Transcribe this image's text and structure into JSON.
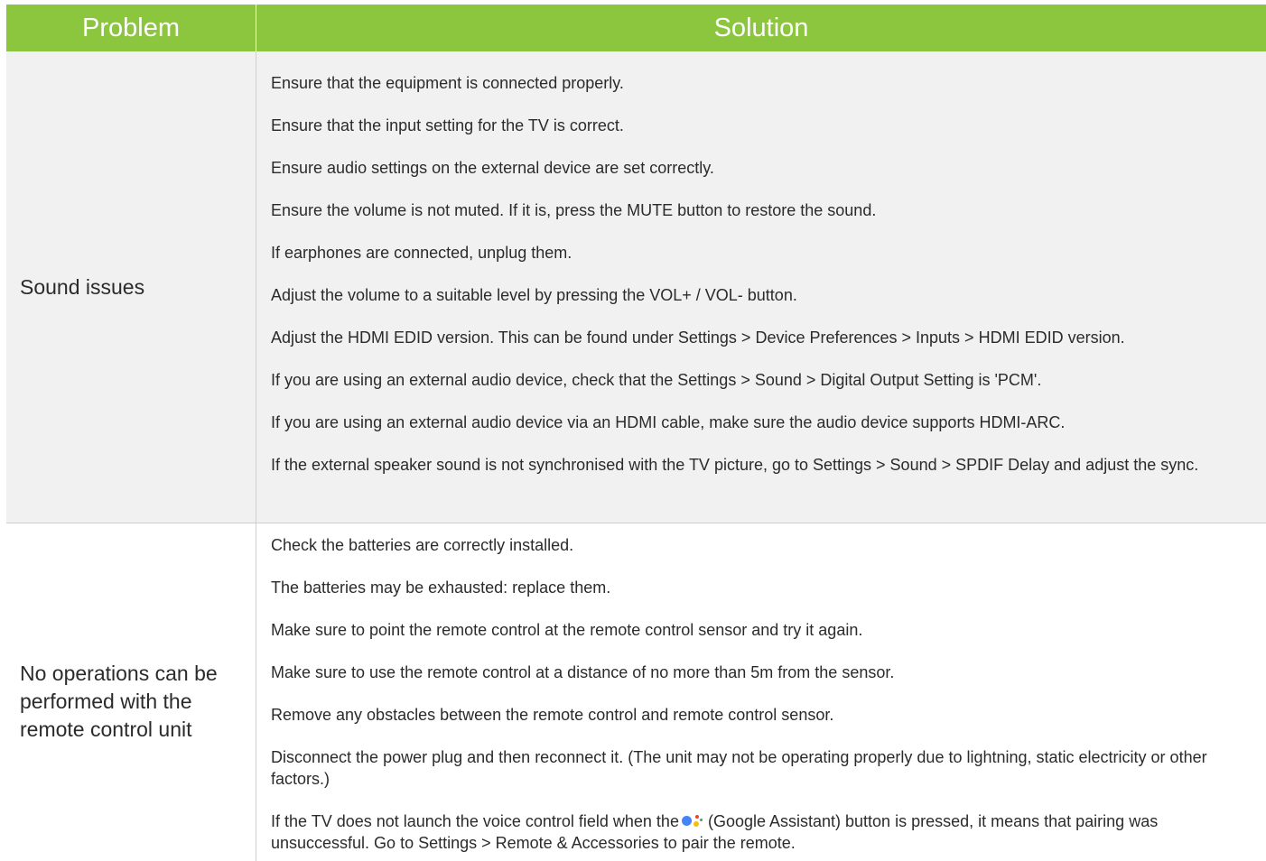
{
  "header": {
    "problem": "Problem",
    "solution": "Solution"
  },
  "rows": [
    {
      "problem": "Sound issues",
      "solutions": [
        "Ensure that the equipment is connected properly.",
        "Ensure that the input setting for the TV is correct.",
        "Ensure audio settings on the external device are set correctly.",
        "Ensure the volume is not muted. If it is, press the MUTE button to restore the sound.",
        "If earphones are connected, unplug them.",
        "Adjust the volume to a suitable level by pressing the VOL+ / VOL- button.",
        "Adjust the HDMI EDID version. This can be found under Settings > Device Preferences > Inputs > HDMI EDID version.",
        "If you are using an external audio device, check that the  Settings > Sound > Digital Output Setting is 'PCM'.",
        "If you are using an external audio device via an HDMI cable, make sure the audio device supports HDMI-ARC.",
        "If the external speaker sound is not synchronised with the TV picture, go to Settings > Sound > SPDIF Delay and adjust the sync."
      ]
    },
    {
      "problem": "No operations can be performed with the remote control unit",
      "solutions": [
        "Check the batteries are correctly installed.",
        "The batteries may be exhausted: replace them.",
        "Make sure to point the remote control at the remote control sensor and try it again.",
        "Make sure to use the remote control at a distance of no more than 5m from the sensor.",
        "Remove any obstacles between the remote control and remote control sensor.",
        "Disconnect the power plug and then reconnect it. (The unit may not be operating properly due to lightning, static electricity or other factors.)"
      ],
      "last_solution_before_icon": "If the TV does not launch the voice control field when the",
      "last_solution_after_icon": " (Google Assistant) button is pressed, it means that pairing was unsuccessful. Go to Settings > Remote & Accessories to pair the remote.",
      "icon": "google-assistant-icon"
    }
  ],
  "colors": {
    "header_bg": "#8cc63f",
    "header_text": "#ffffff",
    "row_alt_bg": "#f1f1f1"
  }
}
